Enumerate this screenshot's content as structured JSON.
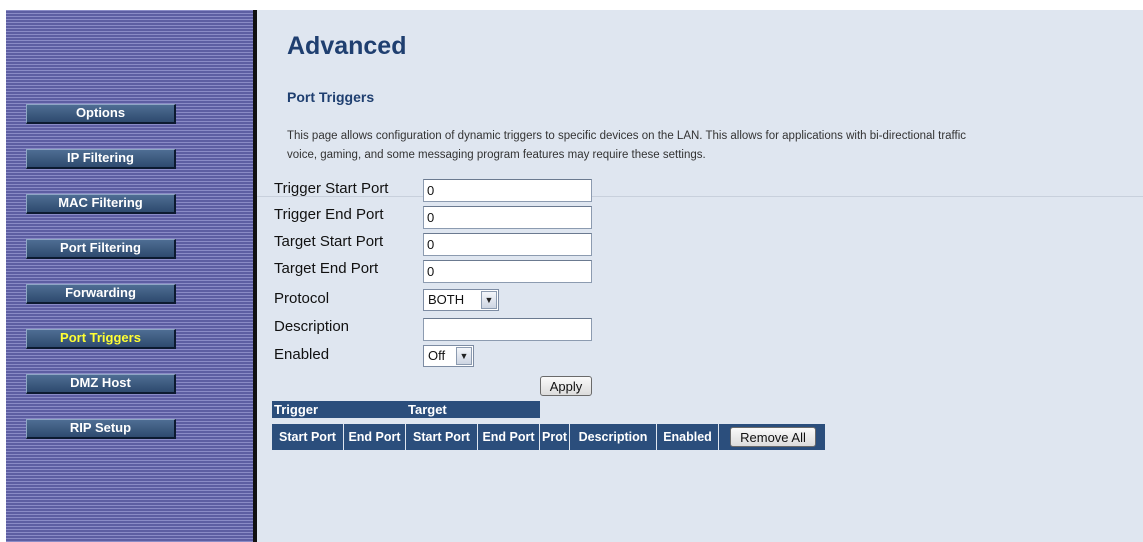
{
  "sidebar": {
    "items": [
      {
        "label": "Options",
        "active": false
      },
      {
        "label": "IP Filtering",
        "active": false
      },
      {
        "label": "MAC Filtering",
        "active": false
      },
      {
        "label": "Port Filtering",
        "active": false
      },
      {
        "label": "Forwarding",
        "active": false
      },
      {
        "label": "Port Triggers",
        "active": true
      },
      {
        "label": "DMZ Host",
        "active": false
      },
      {
        "label": "RIP Setup",
        "active": false
      }
    ]
  },
  "main": {
    "title": "Advanced",
    "section_title": "Port Triggers",
    "description_line1": "This page allows configuration of dynamic triggers to specific devices on the LAN. This allows for applications with bi-directional traffic",
    "description_line2": "voice, gaming, and some messaging program features may require these settings."
  },
  "form": {
    "trigger_start_label": "Trigger Start Port",
    "trigger_start_value": "0",
    "trigger_end_label": "Trigger End Port",
    "trigger_end_value": "0",
    "target_start_label": "Target Start Port",
    "target_start_value": "0",
    "target_end_label": "Target End Port",
    "target_end_value": "0",
    "protocol_label": "Protocol",
    "protocol_value": "BOTH",
    "description_label": "Description",
    "description_value": "",
    "enabled_label": "Enabled",
    "enabled_value": "Off",
    "apply_label": "Apply"
  },
  "table": {
    "group_trigger": "Trigger",
    "group_target": "Target",
    "columns": [
      "Start Port",
      "End Port",
      "Start Port",
      "End Port",
      "Prot",
      "Description",
      "Enabled"
    ],
    "remove_all_label": "Remove All"
  },
  "colors": {
    "header_blue": "#2b4e7c",
    "title_blue": "#1f3f70",
    "active_nav_text": "#ffff33",
    "sidebar_purple": "#6f70b4"
  }
}
